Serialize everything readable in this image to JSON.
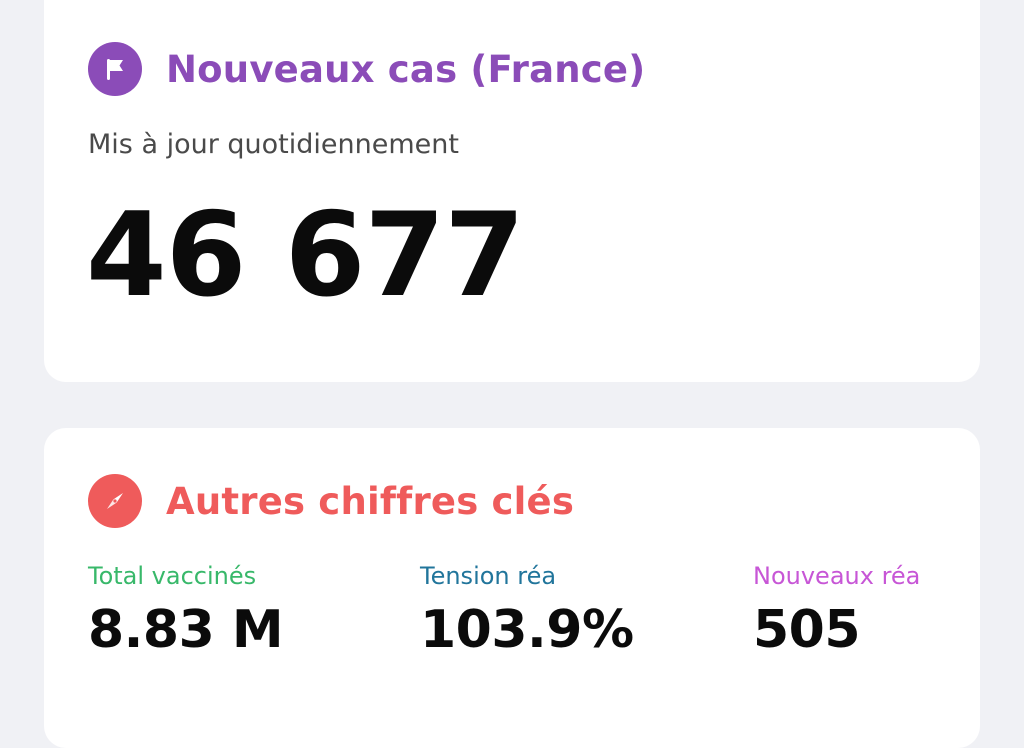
{
  "cases_card": {
    "title": "Nouveaux cas (France)",
    "subtitle": "Mis à jour quotidiennement",
    "value": "46 677",
    "icon": "flag-icon",
    "accent_color": "#8b4cb8"
  },
  "other_card": {
    "title": "Autres chiffres clés",
    "icon": "compass-icon",
    "accent_color": "#ef5b5b",
    "stats": [
      {
        "label": "Total vaccinés",
        "value": "8.83 M",
        "color": "#38b86a"
      },
      {
        "label": "Tension réa",
        "value": "103.9%",
        "color": "#21759b"
      },
      {
        "label": "Nouveaux réa",
        "value": "505",
        "color": "#c756d6"
      }
    ]
  }
}
